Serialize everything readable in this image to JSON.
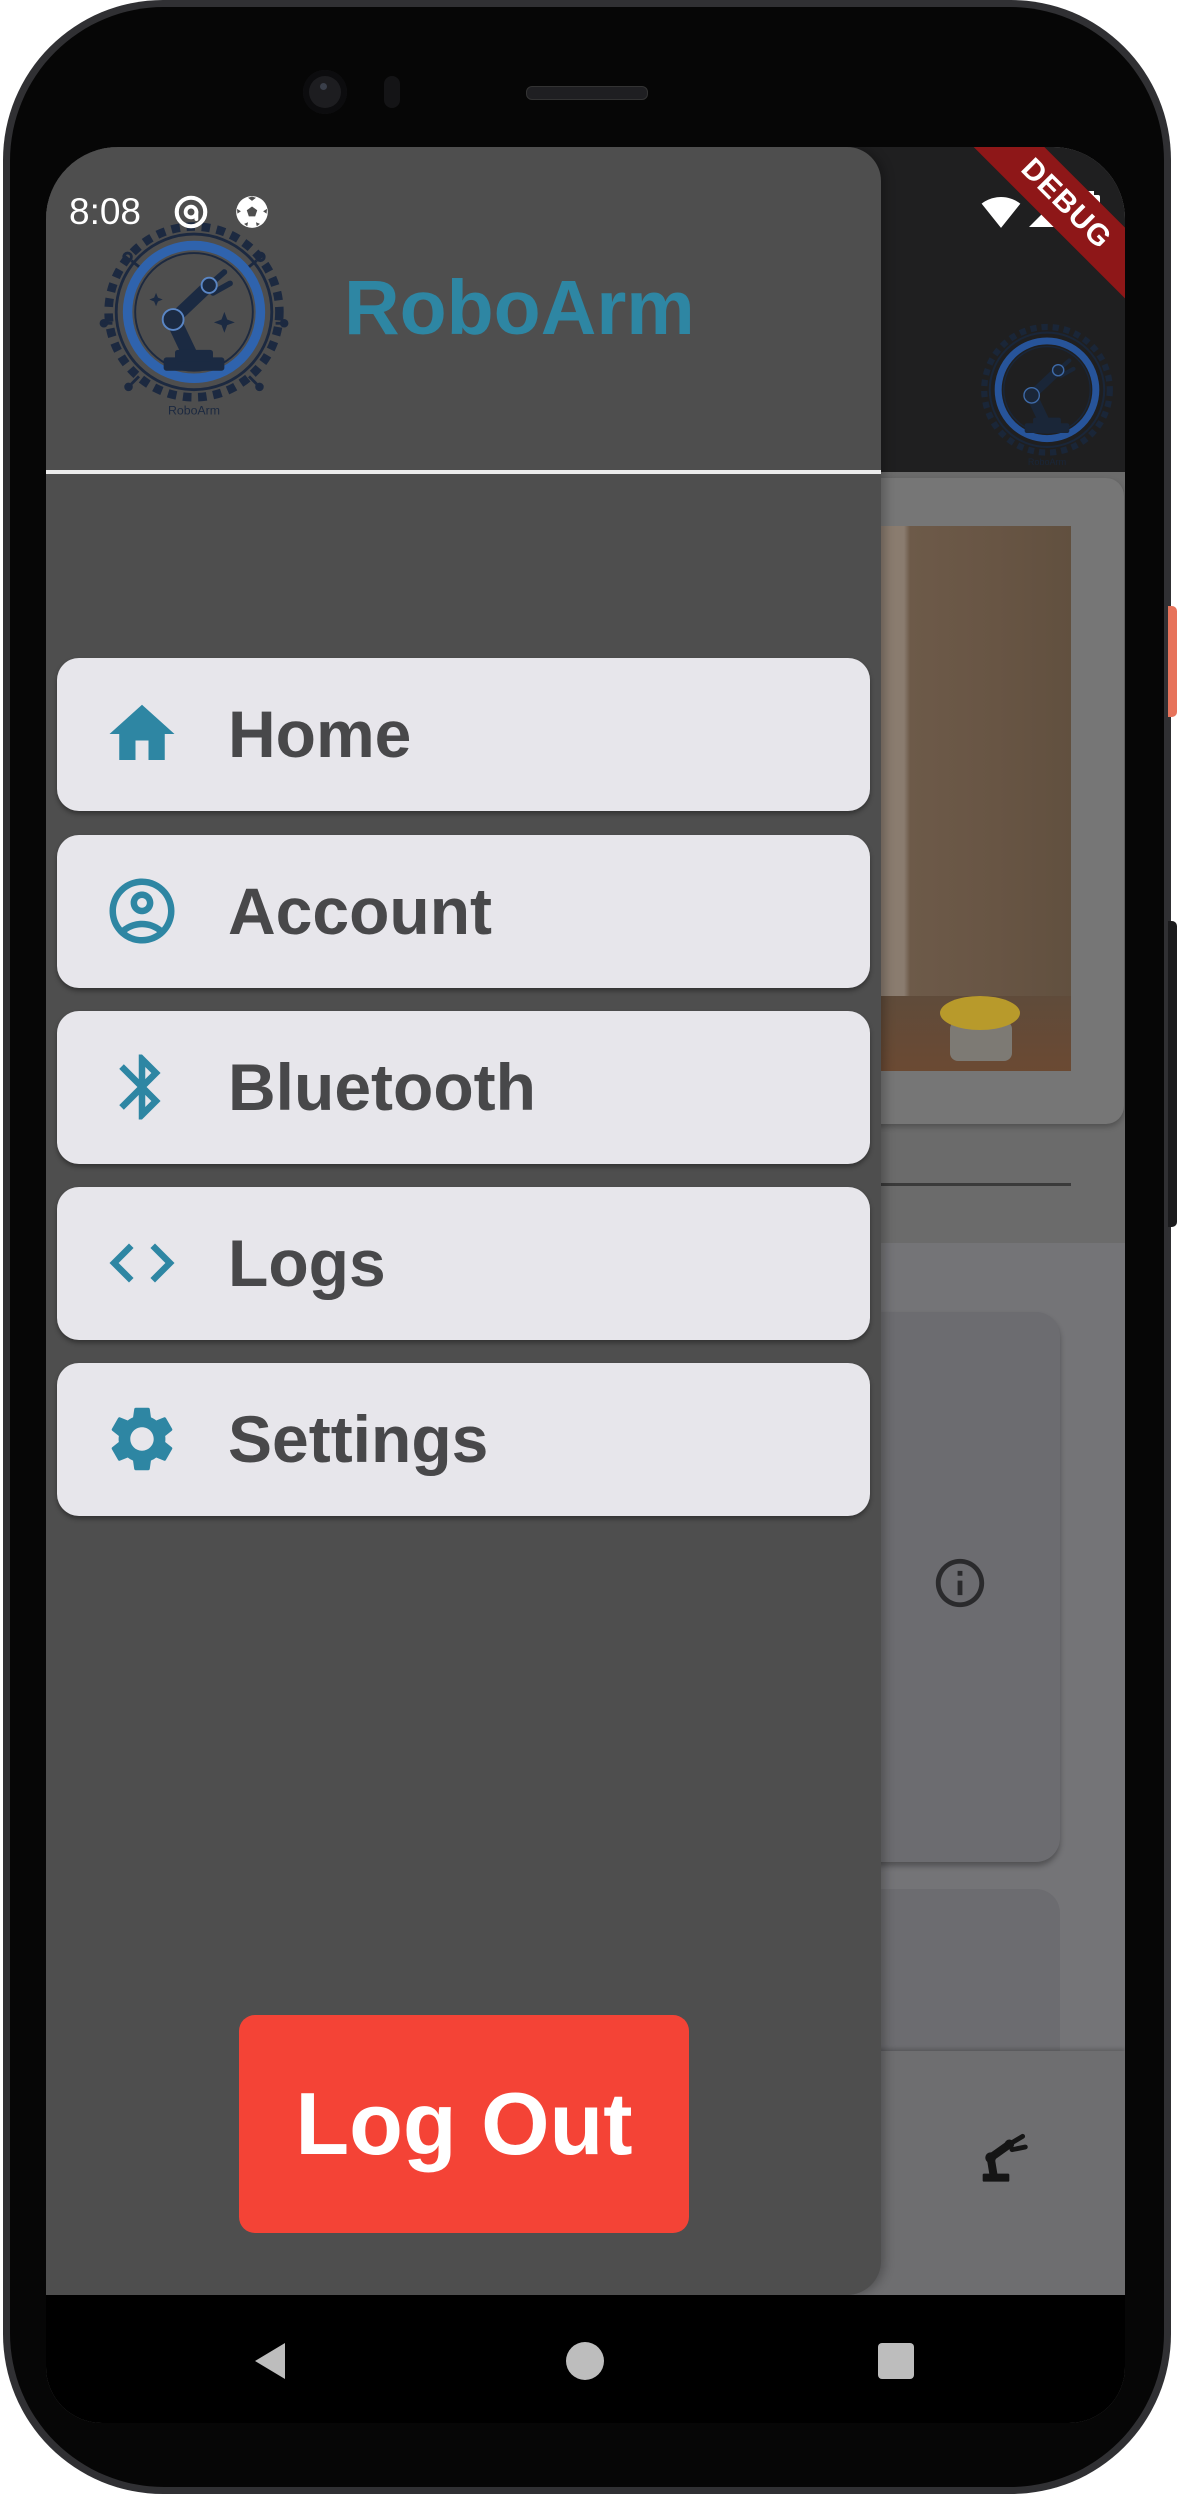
{
  "status_bar": {
    "time": "8:08",
    "icons": [
      "data-saver-icon",
      "soccer-ball-icon",
      "wifi-icon",
      "cell-signal-icon",
      "battery-icon"
    ]
  },
  "debug_banner": "DEBUG",
  "drawer": {
    "app_name": "RoboArm",
    "logo": {
      "icon": "roboarm-logo",
      "caption": "RoboArm"
    },
    "menu": [
      {
        "label": "Home",
        "icon": "home-icon"
      },
      {
        "label": "Account",
        "icon": "account-circle-icon"
      },
      {
        "label": "Bluetooth",
        "icon": "bluetooth-icon"
      },
      {
        "label": "Logs",
        "icon": "code-icon"
      },
      {
        "label": "Settings",
        "icon": "settings-gear-icon"
      }
    ],
    "logout_label": "Log Out"
  },
  "background_app": {
    "app_bar_logo": "roboarm-logo",
    "camera_feed": "camera-feed-image",
    "card_icon": "info-icon",
    "bottom_nav_icon": "robot-arm-icon"
  },
  "system_nav": {
    "buttons": [
      "back-icon",
      "home-circle-icon",
      "recents-square-icon"
    ]
  },
  "colors": {
    "accent": "#2e86a3",
    "menu_item_bg": "#e7e6eb",
    "menu_text": "#48484a",
    "drawer_bg": "#4e4e4e",
    "logout_bg": "#f44336",
    "logout_text": "#ffffff"
  }
}
